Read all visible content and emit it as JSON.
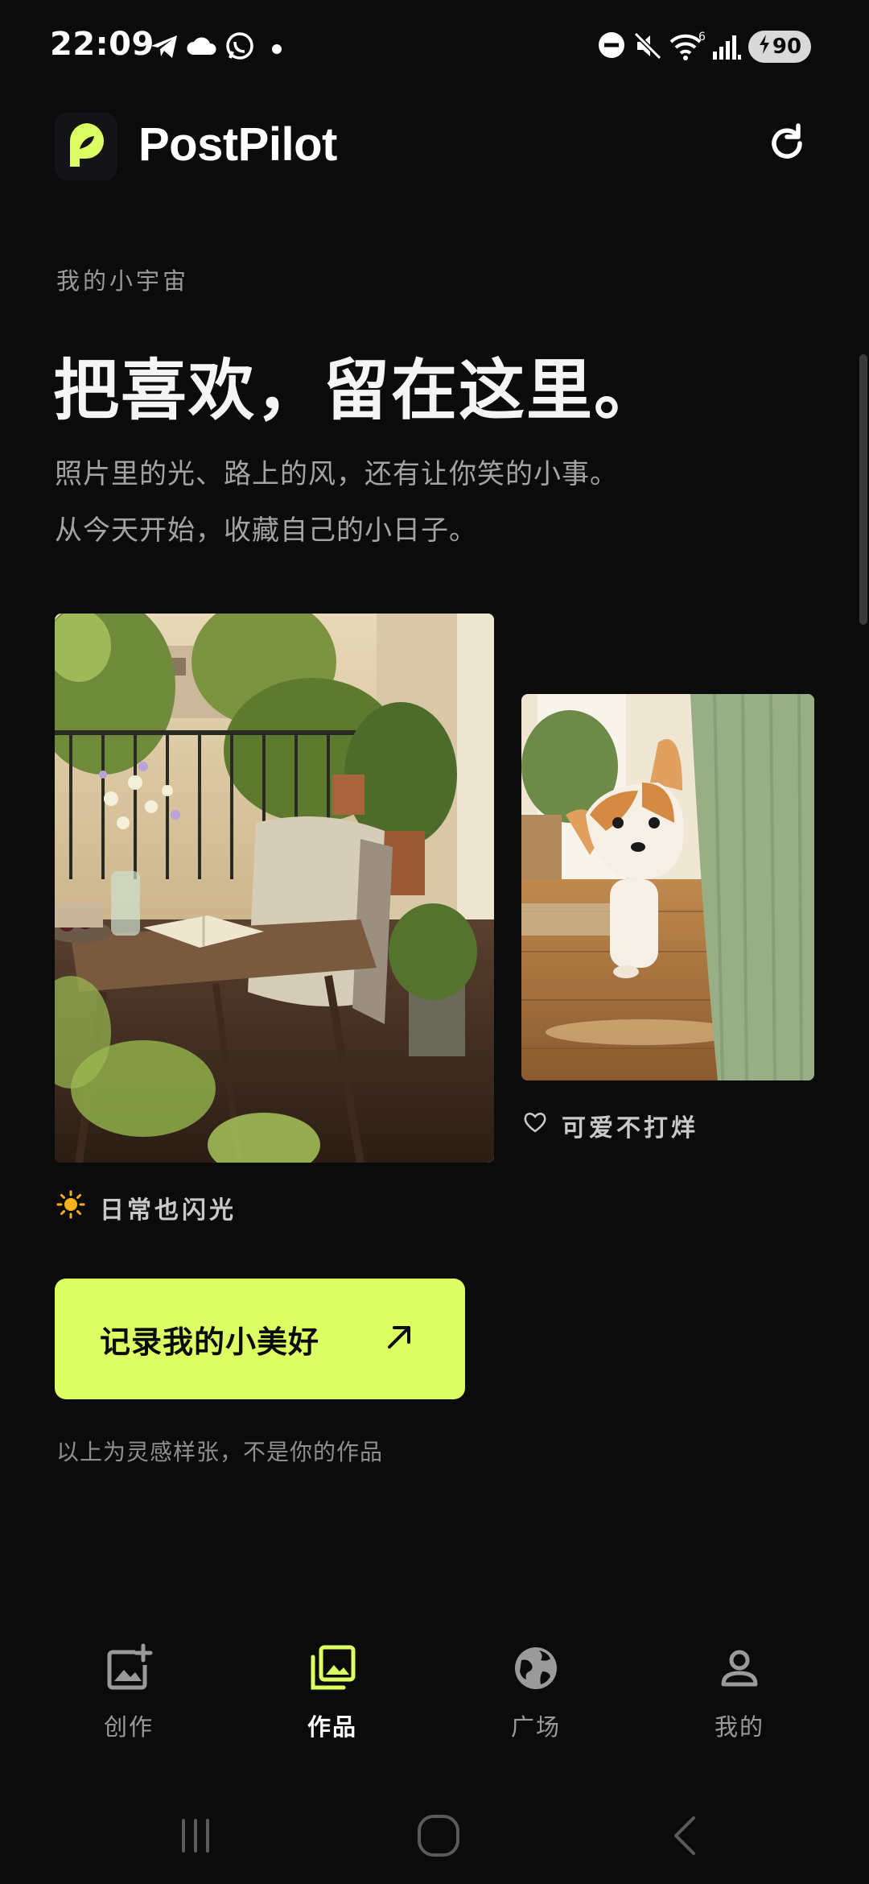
{
  "status_bar": {
    "time": "22:09",
    "battery": "90",
    "icons": [
      "telegram-icon",
      "cloud-icon",
      "whatsapp-icon",
      "dot-icon",
      "dnd-icon",
      "mute-icon",
      "wifi-icon",
      "signal-icon",
      "battery-icon"
    ]
  },
  "header": {
    "app_name": "PostPilot",
    "logo_icon": "pin-logo-icon",
    "refresh_icon": "refresh-icon"
  },
  "hero": {
    "eyebrow": "我的小宇宙",
    "headline": "把喜欢，留在这里。",
    "subtitle_lines": [
      "照片里的光、路上的风，还有让你笑的小事。",
      "从今天开始，收藏自己的小日子。"
    ]
  },
  "gallery": {
    "main_caption": "日常也闪光",
    "main_caption_icon": "sun-icon",
    "side_caption": "可爱不打烊",
    "side_caption_icon": "heart-icon"
  },
  "cta": {
    "label": "记录我的小美好",
    "icon": "arrow-up-right-icon"
  },
  "note": "以上为灵感样张，不是你的作品",
  "tabs": [
    {
      "label": "创作",
      "icon": "add-image-icon",
      "active": false
    },
    {
      "label": "作品",
      "icon": "gallery-icon",
      "active": true
    },
    {
      "label": "广场",
      "icon": "globe-icon",
      "active": false
    },
    {
      "label": "我的",
      "icon": "person-icon",
      "active": false
    }
  ],
  "colors": {
    "background": "#0b0b0b",
    "accent": "#dcff63",
    "text_primary": "#f5f5f5",
    "text_secondary": "#9a9a9a"
  }
}
